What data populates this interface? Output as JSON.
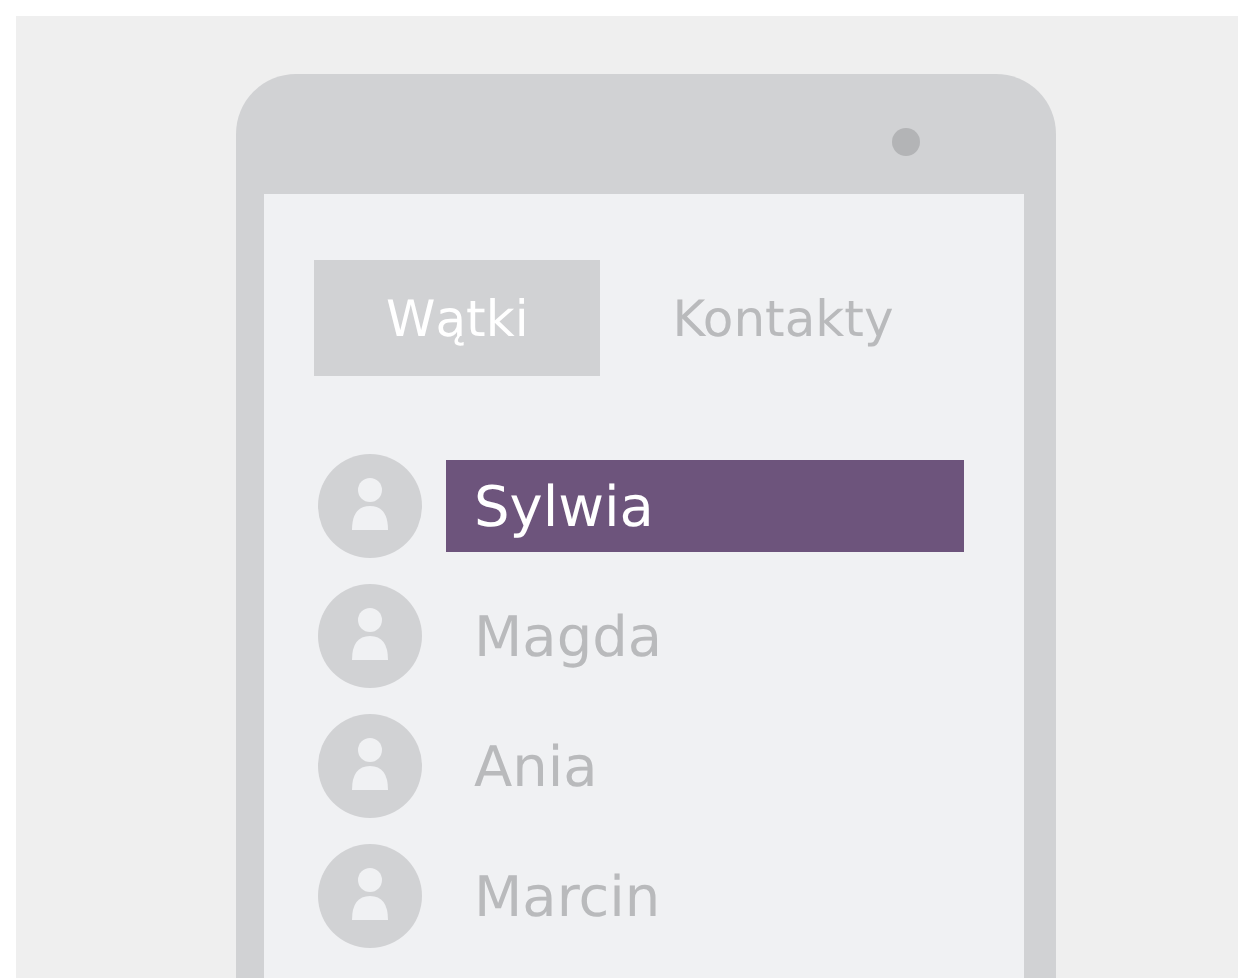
{
  "tabs": [
    {
      "label": "Wątki",
      "selected": true
    },
    {
      "label": "Kontakty",
      "selected": false
    }
  ],
  "contacts": [
    {
      "name": "Sylwia",
      "selected": true
    },
    {
      "name": "Magda",
      "selected": false
    },
    {
      "name": "Ania",
      "selected": false
    },
    {
      "name": "Marcin",
      "selected": false
    }
  ]
}
